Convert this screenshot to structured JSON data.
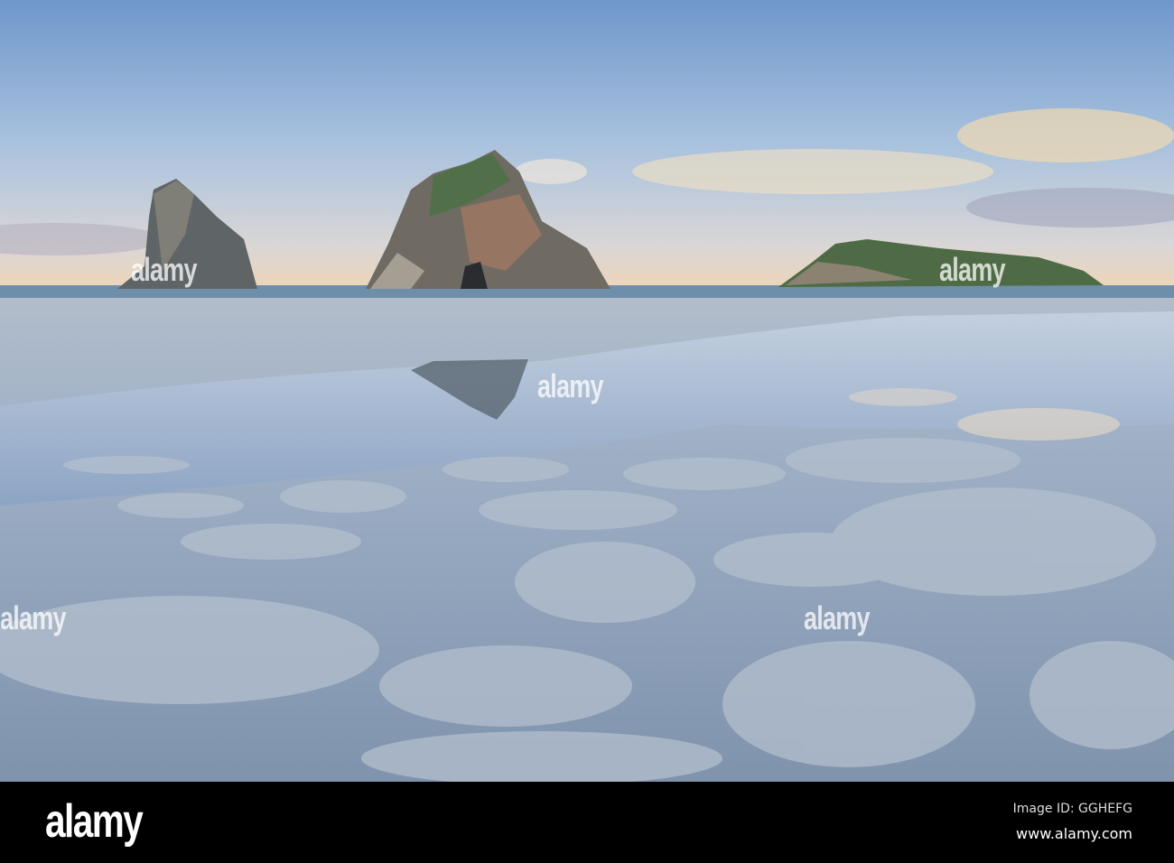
{
  "photo": {
    "watermark_text": "alamy",
    "colors": {
      "sky_top": "#7fa2cf",
      "sky_horizon": "#e9d3b8",
      "sand": "#a3b3c6",
      "water": "#8ea6c6"
    }
  },
  "footer": {
    "logo": "alamy",
    "image_id": "Image ID: GGHEFG",
    "website": "www.alamy.com"
  }
}
